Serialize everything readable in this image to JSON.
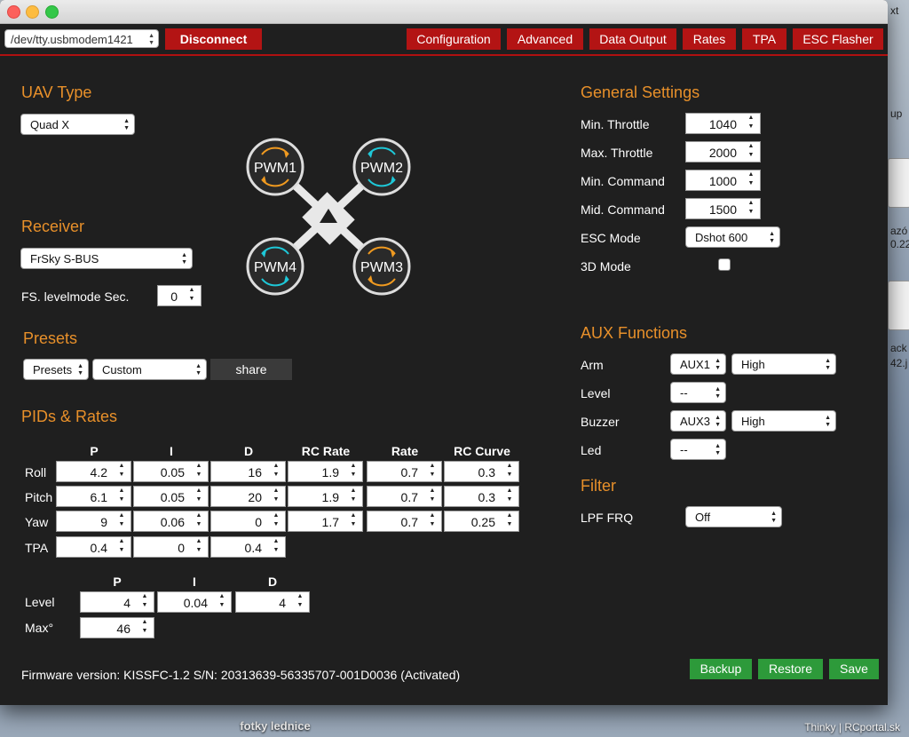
{
  "desktop": {
    "folder_label": "fotky lednice",
    "watermark": "Thinky | RCportal.sk",
    "fragments": [
      "xt",
      "up",
      "azó",
      "0.22",
      "ack",
      "42.j"
    ]
  },
  "toolbar": {
    "port": "/dev/tty.usbmodem1421",
    "disconnect": "Disconnect",
    "tabs": [
      "Configuration",
      "Advanced",
      "Data Output",
      "Rates",
      "TPA",
      "ESC Flasher"
    ]
  },
  "uav": {
    "heading": "UAV Type",
    "type": "Quad X"
  },
  "motors": [
    "PWM1",
    "PWM2",
    "PWM4",
    "PWM3"
  ],
  "receiver": {
    "heading": "Receiver",
    "type": "FrSky S-BUS",
    "fs_label": "FS. levelmode Sec.",
    "fs_value": "0"
  },
  "presets": {
    "heading": "Presets",
    "preset": "Presets",
    "custom": "Custom",
    "share": "share"
  },
  "pids": {
    "heading": "PIDs & Rates",
    "columns": [
      "P",
      "I",
      "D",
      "RC Rate",
      "Rate",
      "RC Curve"
    ],
    "rows": [
      {
        "label": "Roll",
        "values": [
          "4.2",
          "0.05",
          "16",
          "1.9",
          "0.7",
          "0.3"
        ]
      },
      {
        "label": "Pitch",
        "values": [
          "6.1",
          "0.05",
          "20",
          "1.9",
          "0.7",
          "0.3"
        ]
      },
      {
        "label": "Yaw",
        "values": [
          "9",
          "0.06",
          "0",
          "1.7",
          "0.7",
          "0.25"
        ]
      },
      {
        "label": "TPA",
        "values": [
          "0.4",
          "0",
          "0.4"
        ]
      }
    ],
    "level_columns": [
      "P",
      "I",
      "D"
    ],
    "level": {
      "label": "Level",
      "values": [
        "4",
        "0.04",
        "4"
      ]
    },
    "max": {
      "label": "Max°",
      "value": "46"
    }
  },
  "general": {
    "heading": "General Settings",
    "items": [
      {
        "label": "Min. Throttle",
        "value": "1040"
      },
      {
        "label": "Max. Throttle",
        "value": "2000"
      },
      {
        "label": "Min. Command",
        "value": "1000"
      },
      {
        "label": "Mid. Command",
        "value": "1500"
      }
    ],
    "esc_label": "ESC Mode",
    "esc_value": "Dshot 600",
    "mode3d_label": "3D Mode"
  },
  "aux": {
    "heading": "AUX Functions",
    "items": [
      {
        "label": "Arm",
        "channel": "AUX1",
        "state": "High"
      },
      {
        "label": "Level",
        "channel": "--",
        "state": ""
      },
      {
        "label": "Buzzer",
        "channel": "AUX3",
        "state": "High"
      },
      {
        "label": "Led",
        "channel": "--",
        "state": ""
      }
    ]
  },
  "filter": {
    "heading": "Filter",
    "label": "LPF FRQ",
    "value": "Off"
  },
  "footer": {
    "firmware": "Firmware version: KISSFC-1.2 S/N: 20313639-56335707-001D0036 (Activated)",
    "backup": "Backup",
    "restore": "Restore",
    "save": "Save"
  },
  "colors": {
    "accent": "#e8902a",
    "red": "#b31414",
    "green": "#2d9a3a",
    "cyan": "#1ec8d8",
    "orange": "#f09a20"
  }
}
